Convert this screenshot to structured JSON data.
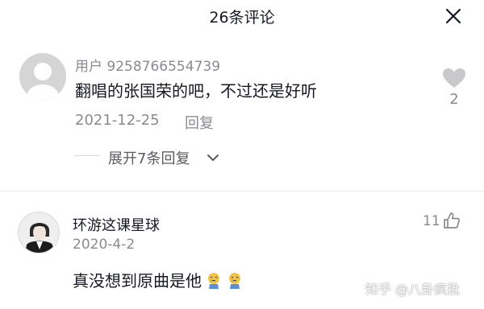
{
  "header": {
    "title": "26条评论",
    "close_icon": "close-icon"
  },
  "comments": [
    {
      "username": "用户 9258766554739",
      "text": "翻唱的张国荣的吧，不过还是好听",
      "date": "2021-12-25",
      "reply_label": "回复",
      "like_count": "2",
      "like_icon": "heart-icon",
      "expand_label": "展开7条回复",
      "expand_icon": "chevron-down-icon"
    },
    {
      "username": "环游这课星球",
      "date": "2020-4-2",
      "text": "真没想到原曲是他",
      "emojis": [
        "crying-emoji",
        "crying-emoji"
      ],
      "like_count": "11",
      "like_icon": "thumbs-up-icon"
    }
  ],
  "watermark": "知乎 @八卦疯批",
  "colors": {
    "text": "#161823",
    "secondary": "#8a8b91",
    "like_heart": "#c9c9cc"
  }
}
